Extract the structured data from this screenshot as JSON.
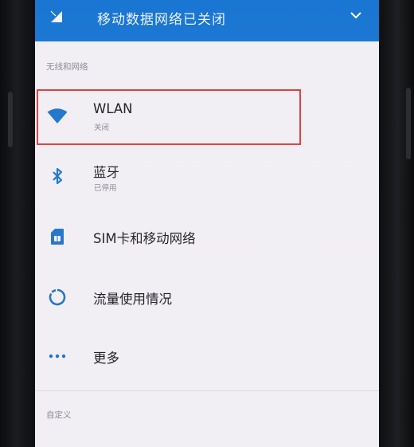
{
  "status_header": {
    "title": "移动数据网络已关闭",
    "signal_icon": "signal-off-icon",
    "expand_icon": "chevron-down-icon",
    "color": "#1976d2"
  },
  "sections": {
    "wireless": {
      "label": "无线和网络"
    },
    "custom": {
      "label": "自定义"
    }
  },
  "settings": {
    "wlan": {
      "label": "WLAN",
      "status": "关闭",
      "icon": "wifi-icon",
      "highlighted": true
    },
    "bluetooth": {
      "label": "蓝牙",
      "status": "已停用",
      "icon": "bluetooth-icon"
    },
    "sim": {
      "label": "SIM卡和移动网络",
      "icon": "sim-card-icon"
    },
    "data_usage": {
      "label": "流量使用情况",
      "icon": "data-usage-icon"
    },
    "more": {
      "label": "更多",
      "icon": "more-icon"
    }
  },
  "colors": {
    "accent": "#1976d2",
    "icon": "#1e73c8",
    "highlight": "#e23b3b",
    "background": "#f1eef4"
  }
}
